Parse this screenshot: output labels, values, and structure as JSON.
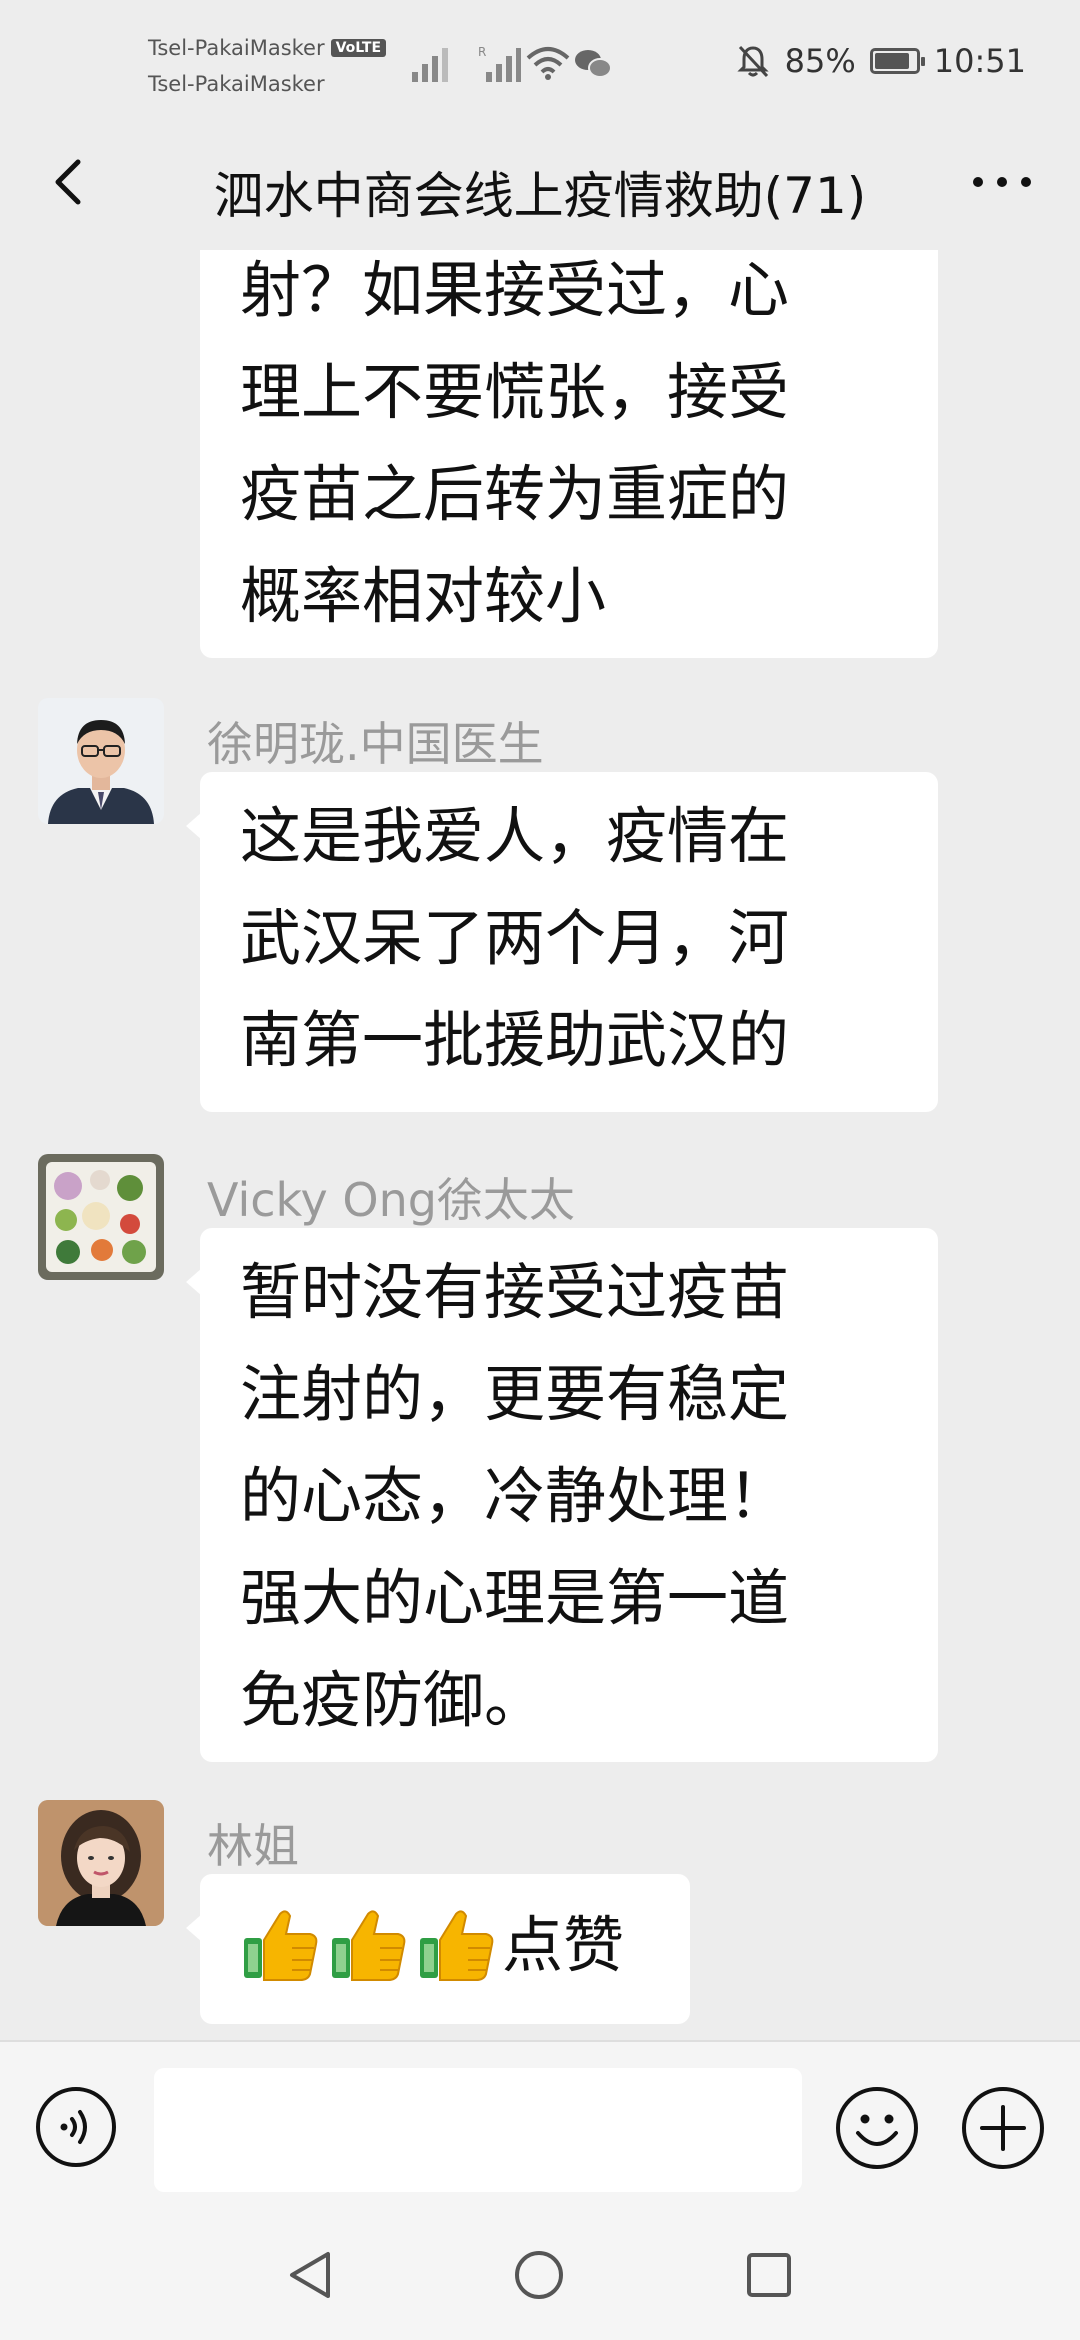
{
  "status_bar": {
    "carrier_1": "Tsel-PakaiMasker",
    "volte": "VoLTE",
    "carrier_2": "Tsel-PakaiMasker",
    "battery": "85%",
    "battery_level": 0.85,
    "time": "10:51"
  },
  "header": {
    "title": "泗水中商会线上疫情救助(71)"
  },
  "messages": [
    {
      "sender": "",
      "lines": [
        "射？如果接受过，心",
        "理上不要慌张，接受",
        "疫苗之后转为重症的",
        "概率相对较小"
      ]
    },
    {
      "sender": "徐明珑.中国医生",
      "lines": [
        "这是我爱人，疫情在",
        "武汉呆了两个月，河",
        "南第一批援助武汉的"
      ]
    },
    {
      "sender": "Vicky Ong徐太太",
      "lines": [
        "暂时没有接受过疫苗",
        "注射的，更要有稳定",
        "的心态，冷静处理！",
        "强大的心理是第一道",
        "免疫防御。"
      ]
    },
    {
      "sender": "林姐",
      "emoji_count": 3,
      "text": "点赞"
    }
  ],
  "input": {
    "placeholder": ""
  },
  "icons": {
    "back": "chevron-left-icon",
    "more": "more-dots-icon",
    "voice": "voice-icon",
    "emoji": "smiley-icon",
    "plus": "plus-icon",
    "thumbs": "thumbs-up-icon"
  }
}
